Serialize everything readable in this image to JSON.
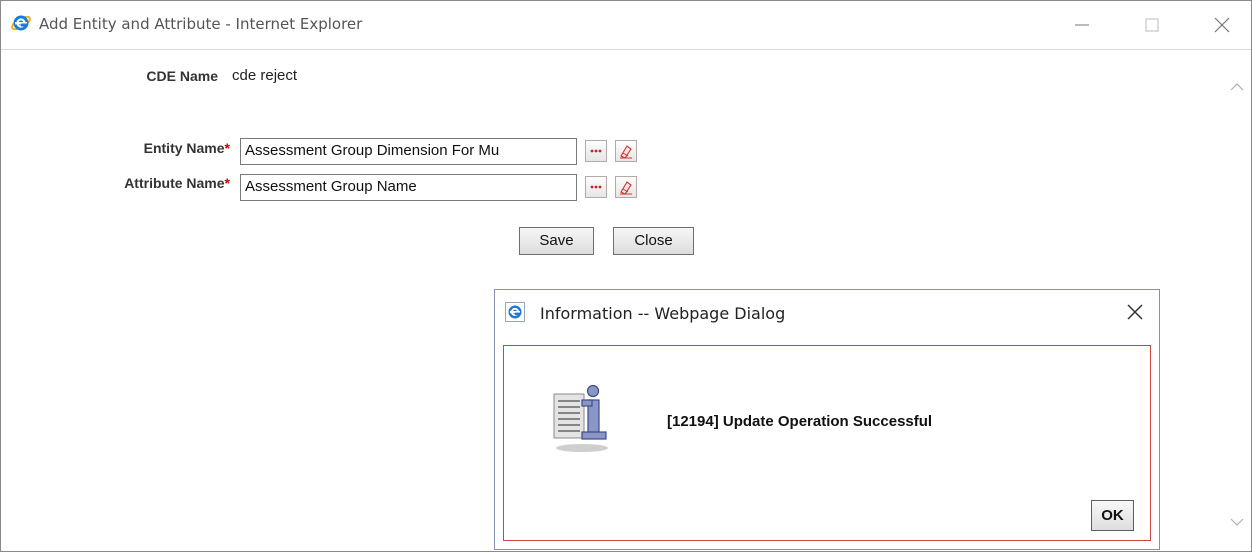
{
  "window": {
    "title": "Add Entity and Attribute - Internet Explorer",
    "icon": "internet-explorer-icon"
  },
  "form": {
    "cde_label": "CDE Name",
    "cde_value": "cde reject",
    "entity_label": "Entity Name",
    "entity_value": "Assessment Group Dimension For Mu",
    "attribute_label": "Attribute Name",
    "attribute_value": "Assessment Group Name",
    "required_marker": "*",
    "browse_icon": "ellipsis-icon",
    "clear_icon": "eraser-icon",
    "save_label": "Save",
    "close_label": "Close"
  },
  "dialog": {
    "title": "Information -- Webpage Dialog",
    "icon": "internet-explorer-icon",
    "message": "[12194] Update Operation Successful",
    "message_icon": "information-icon",
    "ok_label": "OK",
    "border_color": "#c84545"
  }
}
